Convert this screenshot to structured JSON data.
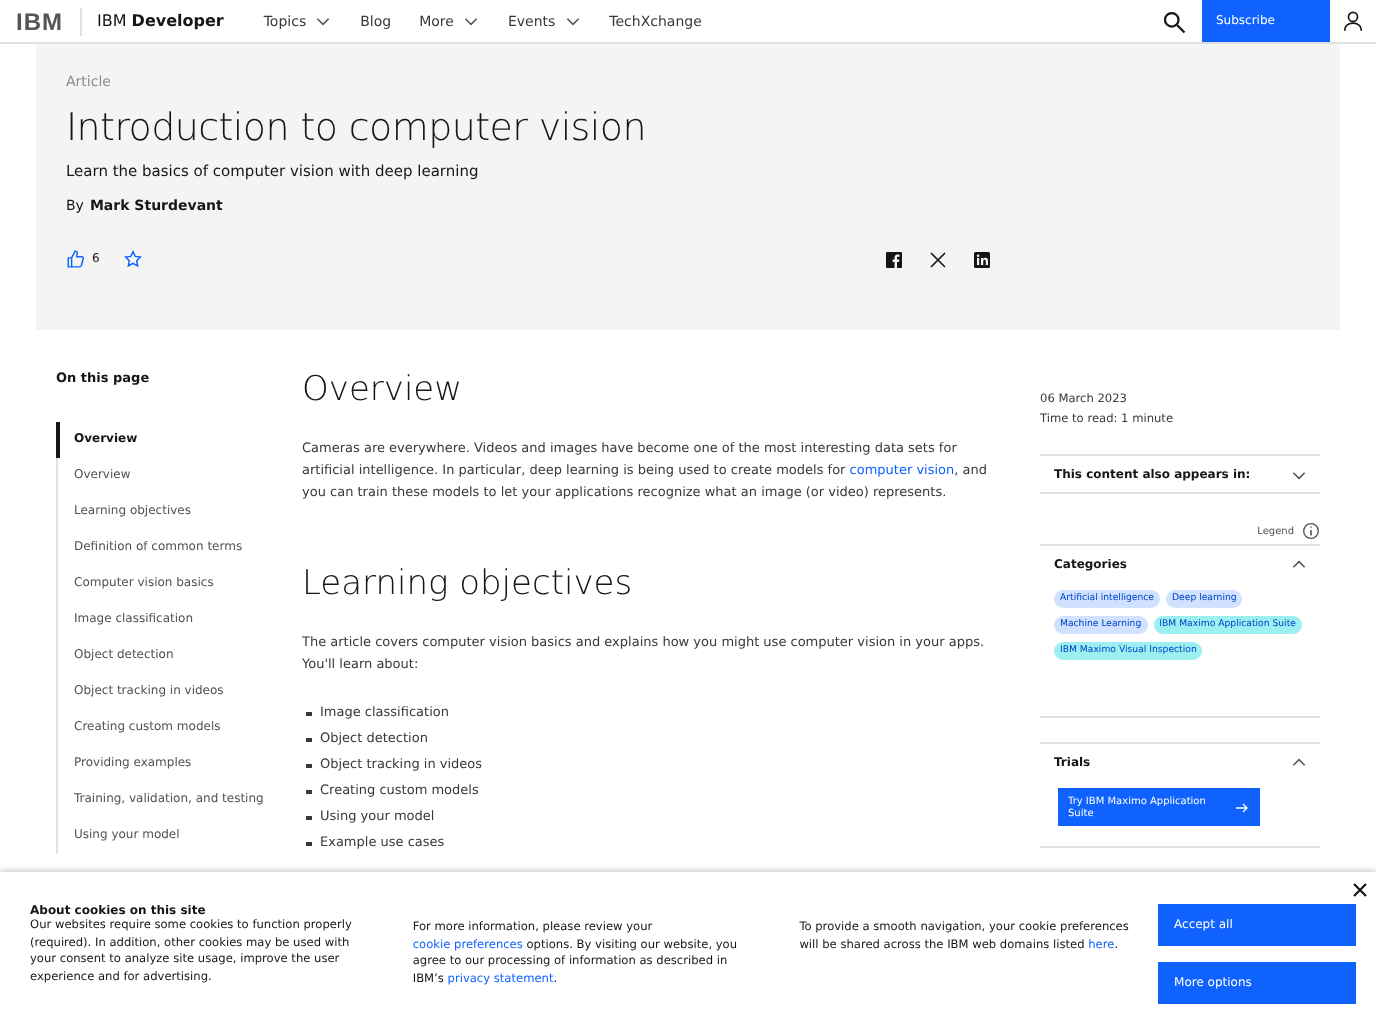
{
  "header": {
    "logo": "IBM",
    "brand_prefix": "IBM",
    "brand_bold": "Developer",
    "nav": [
      {
        "label": "Topics",
        "dropdown": true
      },
      {
        "label": "Blog",
        "dropdown": false
      },
      {
        "label": "More",
        "dropdown": true
      },
      {
        "label": "Events",
        "dropdown": true
      },
      {
        "label": "TechXchange",
        "dropdown": false
      }
    ],
    "subscribe": "Subscribe"
  },
  "hero": {
    "eyebrow": "Article",
    "title": "Introduction to computer vision",
    "subtitle": "Learn the basics of computer vision with deep learning",
    "by": "By",
    "author": "Mark Sturdevant",
    "likes": "6"
  },
  "toc": {
    "heading": "On this page",
    "items": [
      {
        "label": "Overview",
        "selected": true
      },
      {
        "label": "Overview",
        "selected": false
      },
      {
        "label": "Learning objectives",
        "selected": false
      },
      {
        "label": "Definition of common terms",
        "selected": false
      },
      {
        "label": "Computer vision basics",
        "selected": false
      },
      {
        "label": "Image classification",
        "selected": false
      },
      {
        "label": "Object detection",
        "selected": false
      },
      {
        "label": "Object tracking in videos",
        "selected": false
      },
      {
        "label": "Creating custom models",
        "selected": false
      },
      {
        "label": "Providing examples",
        "selected": false
      },
      {
        "label": "Training, validation, and testing",
        "selected": false
      },
      {
        "label": "Using your model",
        "selected": false
      }
    ]
  },
  "article": {
    "sections": [
      {
        "heading": "Overview",
        "paragraphs": [
          [
            {
              "kind": "text",
              "text": "Cameras are everywhere. Videos and images have become one of the most interesting data sets for artificial intelligence. In particular, deep learning is being used to create models for "
            },
            {
              "kind": "link",
              "text": "computer vision"
            },
            {
              "kind": "text",
              "text": ", and you can train these models to let your applications recognize what an image (or video) represents."
            }
          ]
        ]
      },
      {
        "heading": "Learning objectives",
        "paragraphs": [
          [
            {
              "kind": "text",
              "text": "The article covers computer vision basics and explains how you might use computer vision in your apps. You'll learn about:"
            }
          ]
        ],
        "bullets": [
          "Image classification",
          "Object detection",
          "Object tracking in videos",
          "Creating custom models",
          "Using your model",
          "Example use cases"
        ]
      }
    ]
  },
  "aside": {
    "date": "06 March 2023",
    "read_time": "Time to read: 1 minute",
    "also_appears": {
      "title": "This content also appears in:",
      "expanded": false
    },
    "legend": "Legend",
    "categories": {
      "title": "Categories",
      "expanded": true,
      "tags": [
        {
          "label": "Artificial intelligence",
          "color": "#d0e2ff"
        },
        {
          "label": "Deep learning",
          "color": "#d0e2ff"
        },
        {
          "label": "Machine Learning",
          "color": "#d0e2ff"
        },
        {
          "label": "IBM Maximo Application Suite",
          "color": "#9ef0f0"
        },
        {
          "label": "IBM Maximo Visual Inspection",
          "color": "#9ef0f0"
        }
      ]
    },
    "trials": {
      "title": "Trials",
      "expanded": true,
      "button": "Try IBM Maximo Application Suite"
    }
  },
  "cookies": {
    "title": "About cookies on this site",
    "columns": [
      [
        {
          "kind": "text",
          "text": "Our websites require some cookies to function properly (required). In addition, other cookies may be used with your consent to analyze site usage, improve the user experience and for advertising."
        }
      ],
      [
        {
          "kind": "text",
          "text": "For more information, please review your "
        },
        {
          "kind": "link",
          "text": "cookie preferences"
        },
        {
          "kind": "text",
          "text": " options. By visiting our website, you agree to our processing of information as described in IBM’s "
        },
        {
          "kind": "link",
          "text": "privacy statement"
        },
        {
          "kind": "text",
          "text": "."
        }
      ],
      [
        {
          "kind": "text",
          "text": "To provide a smooth navigation, your cookie preferences will be shared across the IBM web domains listed "
        },
        {
          "kind": "link",
          "text": "here"
        },
        {
          "kind": "text",
          "text": "."
        }
      ]
    ],
    "accept": "Accept all",
    "more": "More options"
  }
}
